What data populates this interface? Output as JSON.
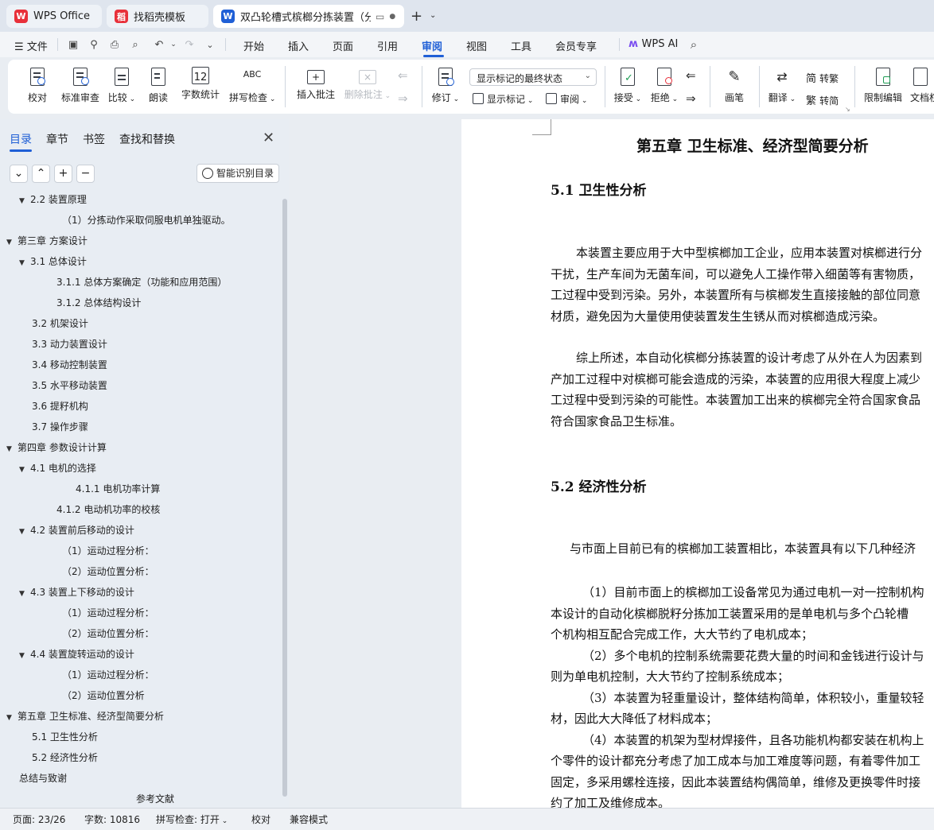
{
  "tabs": [
    {
      "label": "WPS Office",
      "logo": "W",
      "color": "#e8303a",
      "active": false
    },
    {
      "label": "找稻壳模板",
      "logo": "稻",
      "color": "#e8303a",
      "active": false
    },
    {
      "label": "双凸轮槽式槟榔分拣装置（分",
      "logo": "W",
      "color": "#1f5fd6",
      "active": true
    }
  ],
  "tab_extra": {
    "new_tab": "+",
    "dropdown": "⌄"
  },
  "menubar": {
    "file": "文件",
    "items": [
      "开始",
      "插入",
      "页面",
      "引用",
      "审阅",
      "视图",
      "工具",
      "会员专享"
    ],
    "selected": "审阅",
    "wps_ai": "WPS AI"
  },
  "ribbon": {
    "proofread": "校对",
    "standard_review": "标准审查",
    "compare": "比较",
    "read_aloud": "朗读",
    "word_count": "字数统计",
    "spell_check": "拼写检查",
    "insert_comment": "插入批注",
    "delete_comment": "删除批注",
    "track_changes": "修订",
    "markup_state": "显示标记的最终状态",
    "show_markup": "显示标记",
    "review": "审阅",
    "accept": "接受",
    "reject": "拒绝",
    "ink": "画笔",
    "translate": "翻译",
    "to_traditional": "转繁",
    "to_simplified": "转简",
    "restrict_editing": "限制编辑",
    "document_rights": "文档权"
  },
  "nav": {
    "tabs": [
      "目录",
      "章节",
      "书签",
      "查找和替换"
    ],
    "selected": "目录",
    "buttons": [
      "⌄",
      "⌃",
      "+",
      "−"
    ],
    "smart_toc": "智能识别目录",
    "toc": [
      {
        "text": "2.2  装置原理",
        "level": 1,
        "caret": "▼"
      },
      {
        "text": "（1）分拣动作采取伺服电机单独驱动。",
        "level": 3,
        "caret": ""
      },
      {
        "text": "第三章   方案设计",
        "level": 0,
        "caret": "▼"
      },
      {
        "text": "3.1    总体设计",
        "level": 1,
        "caret": "▼"
      },
      {
        "text": "3.1.1  总体方案确定（功能和应用范围）",
        "level": 2,
        "caret": ""
      },
      {
        "text": "3.1.2  总体结构设计",
        "level": 2,
        "caret": ""
      },
      {
        "text": "3.2    机架设计",
        "level": 1,
        "caret": ""
      },
      {
        "text": "3.3    动力装置设计",
        "level": 1,
        "caret": ""
      },
      {
        "text": "3.4    移动控制装置",
        "level": 1,
        "caret": ""
      },
      {
        "text": "3.5    水平移动装置",
        "level": 1,
        "caret": ""
      },
      {
        "text": "3.6    提籽机构",
        "level": 1,
        "caret": ""
      },
      {
        "text": "3.7    操作步骤",
        "level": 1,
        "caret": ""
      },
      {
        "text": "第四章  参数设计计算",
        "level": 0,
        "caret": "▼"
      },
      {
        "text": "4.1  电机的选择",
        "level": 1,
        "caret": "▼"
      },
      {
        "text": "4.1.1  电机功率计算",
        "level": 4,
        "caret": ""
      },
      {
        "text": "4.1.2  电动机功率的校核",
        "level": 2,
        "caret": ""
      },
      {
        "text": "4.2    装置前后移动的设计",
        "level": 1,
        "caret": "▼"
      },
      {
        "text": "（1）运动过程分析：",
        "level": 3,
        "caret": ""
      },
      {
        "text": "（2）运动位置分析：",
        "level": 3,
        "caret": ""
      },
      {
        "text": "4.3    装置上下移动的设计",
        "level": 1,
        "caret": "▼"
      },
      {
        "text": "（1）运动过程分析：",
        "level": 3,
        "caret": ""
      },
      {
        "text": "（2）运动位置分析：",
        "level": 3,
        "caret": ""
      },
      {
        "text": "4.4  装置旋转运动的设计",
        "level": 1,
        "caret": "▼"
      },
      {
        "text": "（1）运动过程分析：",
        "level": 3,
        "caret": ""
      },
      {
        "text": "（2）运动位置分析",
        "level": 3,
        "caret": ""
      },
      {
        "text": "第五章   卫生标准、经济型简要分析",
        "level": 0,
        "caret": "▼"
      },
      {
        "text": "5.1  卫生性分析",
        "level": 1,
        "caret": ""
      },
      {
        "text": "5.2  经济性分析",
        "level": 1,
        "caret": ""
      },
      {
        "text": "总结与致谢",
        "level": 0,
        "caret": ""
      },
      {
        "text": "参考文献",
        "level": 5,
        "caret": ""
      }
    ]
  },
  "doc": {
    "title": "第五章    卫生标准、经济型简要分析",
    "h_5_1": "5.1  卫生性分析",
    "p1": [
      "本装置主要应用于大中型槟榔加工企业，应用本装置对槟榔进行分",
      "干扰，生产车间为无菌车间，可以避免人工操作带入细菌等有害物质，",
      "工过程中受到污染。另外，本装置所有与槟榔发生直接接触的部位同意",
      "材质，避免因为大量使用使装置发生生锈从而对槟榔造成污染。"
    ],
    "p2": [
      "综上所述，本自动化槟榔分拣装置的设计考虑了从外在人为因素到",
      "产加工过程中对槟榔可能会造成的污染，本装置的应用很大程度上减少",
      "工过程中受到污染的可能性。本装置加工出来的槟榔完全符合国家食品",
      "符合国家食品卫生标准。"
    ],
    "h_5_2": "5.2  经济性分析",
    "p3": "与市面上目前已有的槟榔加工装置相比，本装置具有以下几种经济",
    "p4": [
      "（1）目前市面上的槟榔加工设备常见为通过电机一对一控制机构",
      "本设计的自动化槟榔脱籽分拣加工装置采用的是单电机与多个凸轮槽",
      "个机构相互配合完成工作，大大节约了电机成本；",
      "（2）多个电机的控制系统需要花费大量的时间和金钱进行设计与",
      "则为单电机控制，大大节约了控制系统成本；",
      "（3）本装置为轻重量设计，整体结构简单，体积较小，重量较轻",
      "材，因此大大降低了材料成本；",
      "（4）本装置的机架为型材焊接件，且各功能机构都安装在机构上",
      "个零件的设计都充分考虑了加工成本与加工难度等问题，有着零件加工",
      "固定，多采用螺栓连接，因此本装置结构偶简单，维修及更换零件时接",
      "约了加工及维修成本。"
    ]
  },
  "status": {
    "page": "页面: 23/26",
    "words": "字数: 10816",
    "spell": "拼写检查: 打开",
    "proof": "校对",
    "compat": "兼容模式"
  }
}
